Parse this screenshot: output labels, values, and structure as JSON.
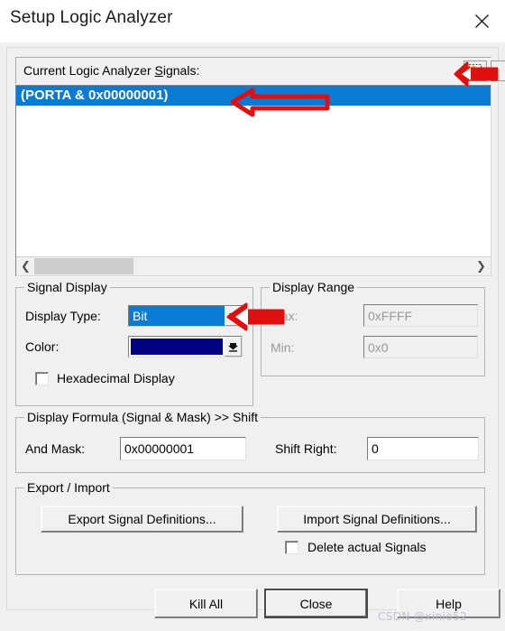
{
  "window": {
    "title": "Setup Logic Analyzer",
    "close_icon": "close-icon"
  },
  "signals": {
    "header_label_before": "Current Logic Analyzer ",
    "header_label_accel": "S",
    "header_label_after": "ignals:",
    "header_label_full": "Current Logic Analyzer Signals:",
    "new_signal_icon": "new-signal-icon",
    "items": [
      {
        "text": "(PORTA & 0x00000001)",
        "selected": true
      }
    ],
    "scrollbar": {
      "left_icon": "chevron-left-icon",
      "right_icon": "chevron-right-icon"
    }
  },
  "signal_display": {
    "title": "Signal Display",
    "display_type_label": "Display Type:",
    "display_type_value": "Bit",
    "display_type_arrow_icon": "chevron-down-icon",
    "color_label": "Color:",
    "color_value": "#000080",
    "color_arrow_icon": "color-dropdown-icon",
    "hex_checkbox_label": "Hexadecimal Display",
    "hex_checked": false
  },
  "display_range": {
    "title": "Display Range",
    "max_label": "Max:",
    "max_value": "0xFFFF",
    "min_label": "Min:",
    "min_value": "0x0",
    "disabled": true
  },
  "display_formula": {
    "title": "Display Formula (Signal & Mask) >> Shift",
    "and_mask_label": "And Mask:",
    "and_mask_value": "0x00000001",
    "shift_right_label": "Shift Right:",
    "shift_right_value": "0"
  },
  "export_import": {
    "title": "Export / Import",
    "export_button": "Export Signal Definitions...",
    "import_button": "Import Signal Definitions...",
    "delete_checkbox_label": "Delete actual Signals",
    "delete_checked": false
  },
  "footer": {
    "kill_all_button": "Kill All",
    "close_button": "Close",
    "help_button": "Help"
  },
  "annotations": {
    "color": "#e01010",
    "arrow_new_signal": "arrow-pointing-new-signal-button",
    "arrow_signal_item": "arrow-pointing-signal-list-item",
    "arrow_display_type": "arrow-pointing-display-type-combo"
  },
  "watermark": {
    "text": "CSDN @xinio52"
  }
}
